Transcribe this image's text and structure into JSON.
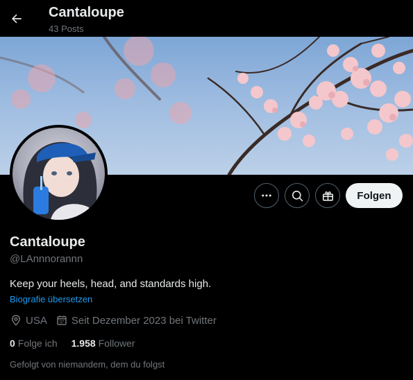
{
  "header": {
    "title": "Cantaloupe",
    "post_count": "43 Posts",
    "back_icon": "arrow-left-icon"
  },
  "profile": {
    "display_name": "Cantaloupe",
    "handle": "@LAnnnorannn",
    "bio": "Keep your heels, head, and standards high.",
    "translate_link": "Biografie übersetzen",
    "location": "USA",
    "joined": "Seit Dezember 2023 bei Twitter",
    "following_count": "0",
    "following_label": "Folge ich",
    "followers_count": "1.958",
    "followers_label": "Follower",
    "followed_by": "Gefolgt von niemandem, dem du folgst"
  },
  "actions": {
    "more_icon": "more-horizontal-icon",
    "search_icon": "search-icon",
    "subscribe_icon": "gift-icon",
    "follow_label": "Folgen"
  },
  "colors": {
    "background": "#000000",
    "text_primary": "#e7e9ea",
    "text_secondary": "#71767b",
    "link": "#1d9bf0",
    "button_bg": "#eff3f4"
  }
}
